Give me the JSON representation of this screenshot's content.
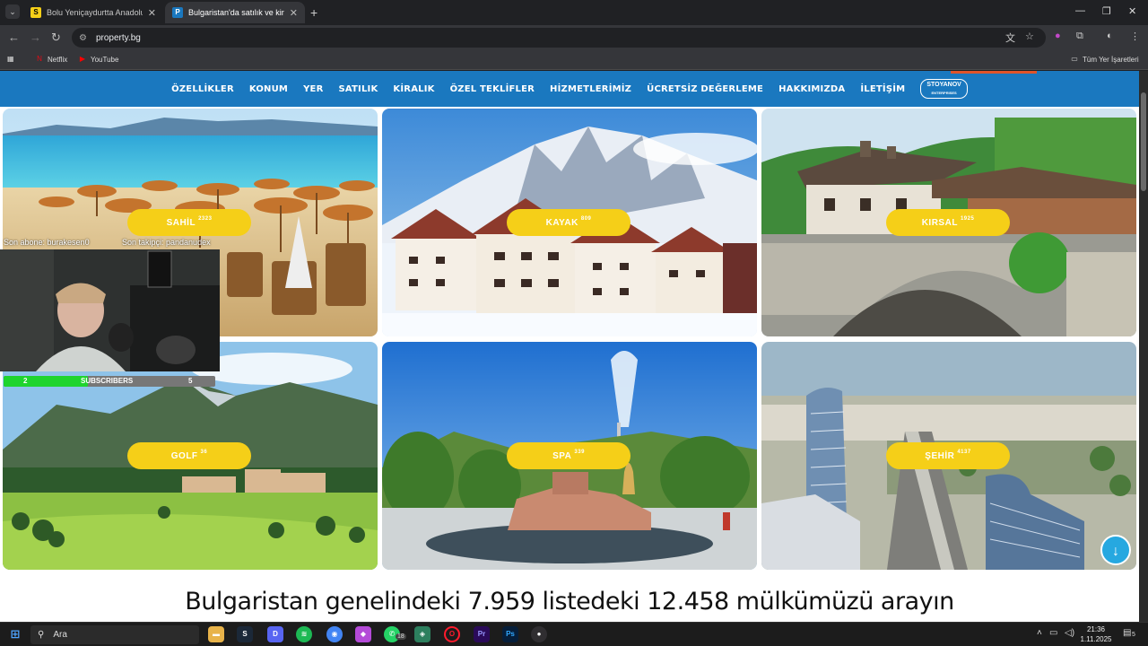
{
  "browser": {
    "tabs": [
      {
        "favicon": "S",
        "title": "Bolu Yeniçaydurtta Anadolu Otel",
        "active": false
      },
      {
        "favicon": "P",
        "title": "Bulgaristan'da satılık ve kiralık",
        "active": true
      }
    ],
    "url": "property.bg",
    "bookmarks": [
      {
        "label": "Netflix",
        "icon": "netflix-icon"
      },
      {
        "label": "YouTube",
        "icon": "youtube-icon"
      }
    ],
    "all_bookmarks_label": "Tüm Yer İşaretleri"
  },
  "site": {
    "nav": [
      "ÖZELLİKLER",
      "KONUM",
      "YER",
      "SATILIK",
      "KİRALIK",
      "ÖZEL TEKLİFLER",
      "HİZMETLERİMİZ",
      "ÜCRETSİZ DEĞERLEME",
      "HAKKIMIZDA",
      "İLETİŞİM"
    ],
    "brand_line1": "STOYANOV",
    "brand_line2": "ENTERPRISES",
    "categories": [
      {
        "label": "SAHİL",
        "count": "2323",
        "scene": "beach"
      },
      {
        "label": "KAYAK",
        "count": "809",
        "scene": "ski"
      },
      {
        "label": "KIRSAL",
        "count": "1925",
        "scene": "rural"
      },
      {
        "label": "GOLF",
        "count": "36",
        "scene": "golf"
      },
      {
        "label": "SPA",
        "count": "339",
        "scene": "spa"
      },
      {
        "label": "ŞEHİR",
        "count": "4137",
        "scene": "city"
      }
    ],
    "headline": "Bulgaristan genelindeki 7.959 listedeki 12.458 mülkümüzü arayın",
    "colors": {
      "nav_bg": "#1a78bf",
      "badge": "#f5cf18",
      "scroll_button": "#26a8e0"
    }
  },
  "stream_overlay": {
    "last_subscriber": "Son abone: burakesen0",
    "last_follower": "Son takipçi: pandanudex",
    "sub_current": "2",
    "sub_label": "SUBSCRIBERS",
    "sub_goal": "5",
    "sub_progress": 0.4
  },
  "taskbar": {
    "search_label": "Ara",
    "time": "21:36",
    "date": "1.11.2025",
    "whatsapp_badge": "18",
    "notification_count": "5"
  }
}
